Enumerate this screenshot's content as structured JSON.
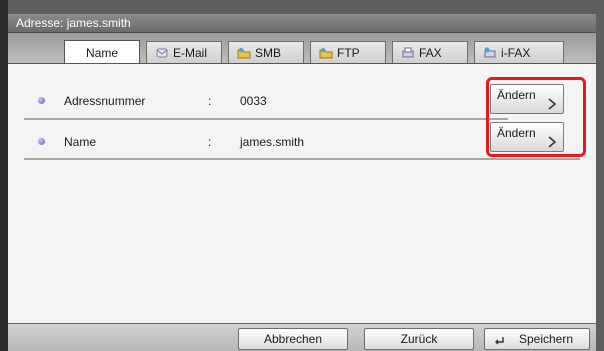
{
  "window": {
    "title": "Adresse: james.smith"
  },
  "tabs": [
    {
      "label": "Name",
      "icon": "none",
      "active": true
    },
    {
      "label": "E-Mail",
      "icon": "envelope-icon",
      "active": false
    },
    {
      "label": "SMB",
      "icon": "folder-icon",
      "active": false
    },
    {
      "label": "FTP",
      "icon": "folder-icon",
      "active": false
    },
    {
      "label": "FAX",
      "icon": "fax-icon",
      "active": false
    },
    {
      "label": "i-FAX",
      "icon": "ifax-icon",
      "active": false
    }
  ],
  "rows": [
    {
      "label": "Adressnummer",
      "separator": ":",
      "value": "0033",
      "button": "Ändern"
    },
    {
      "label": "Name",
      "separator": ":",
      "value": "james.smith",
      "button": "Ändern"
    }
  ],
  "footer": {
    "cancel": "Abbrechen",
    "back": "Zurück",
    "save": "Speichern"
  },
  "colors": {
    "highlight": "#e3191e",
    "bullet": "#5b5bb0"
  }
}
